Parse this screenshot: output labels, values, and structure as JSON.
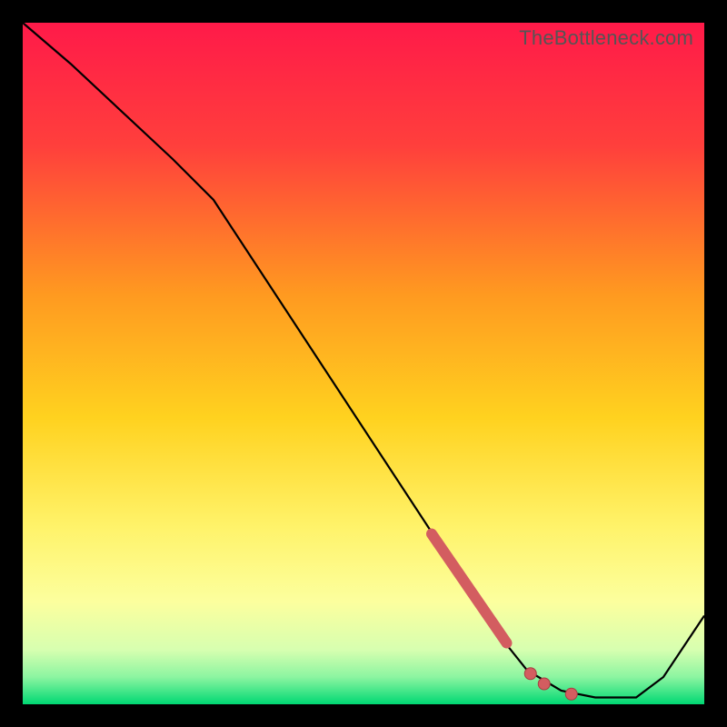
{
  "watermark": "TheBottleneck.com",
  "colors": {
    "gradient_top": "#ff1a49",
    "gradient_mid1": "#ff6d2c",
    "gradient_mid2": "#ffd21f",
    "gradient_mid3": "#fff36a",
    "gradient_mid4": "#f6ffb3",
    "gradient_bottom": "#00d873",
    "curve": "#000000",
    "point_fill": "#d35d60",
    "point_stroke": "#a73f42"
  },
  "chart_data": {
    "type": "line",
    "title": "",
    "xlabel": "",
    "ylabel": "",
    "xlim": [
      0,
      100
    ],
    "ylim": [
      0,
      100
    ],
    "grid": false,
    "curve": [
      {
        "x": 0,
        "y": 100
      },
      {
        "x": 7,
        "y": 94
      },
      {
        "x": 22,
        "y": 80
      },
      {
        "x": 28,
        "y": 74
      },
      {
        "x": 70,
        "y": 10
      },
      {
        "x": 74,
        "y": 5
      },
      {
        "x": 79,
        "y": 2
      },
      {
        "x": 84,
        "y": 1
      },
      {
        "x": 90,
        "y": 1
      },
      {
        "x": 94,
        "y": 4
      },
      {
        "x": 100,
        "y": 13
      }
    ],
    "highlight_segment": {
      "start": {
        "x": 60,
        "y": 25
      },
      "end": {
        "x": 71,
        "y": 9
      }
    },
    "points": [
      {
        "x": 74.5,
        "y": 4.5
      },
      {
        "x": 76.5,
        "y": 3
      },
      {
        "x": 80.5,
        "y": 1.5
      }
    ]
  }
}
